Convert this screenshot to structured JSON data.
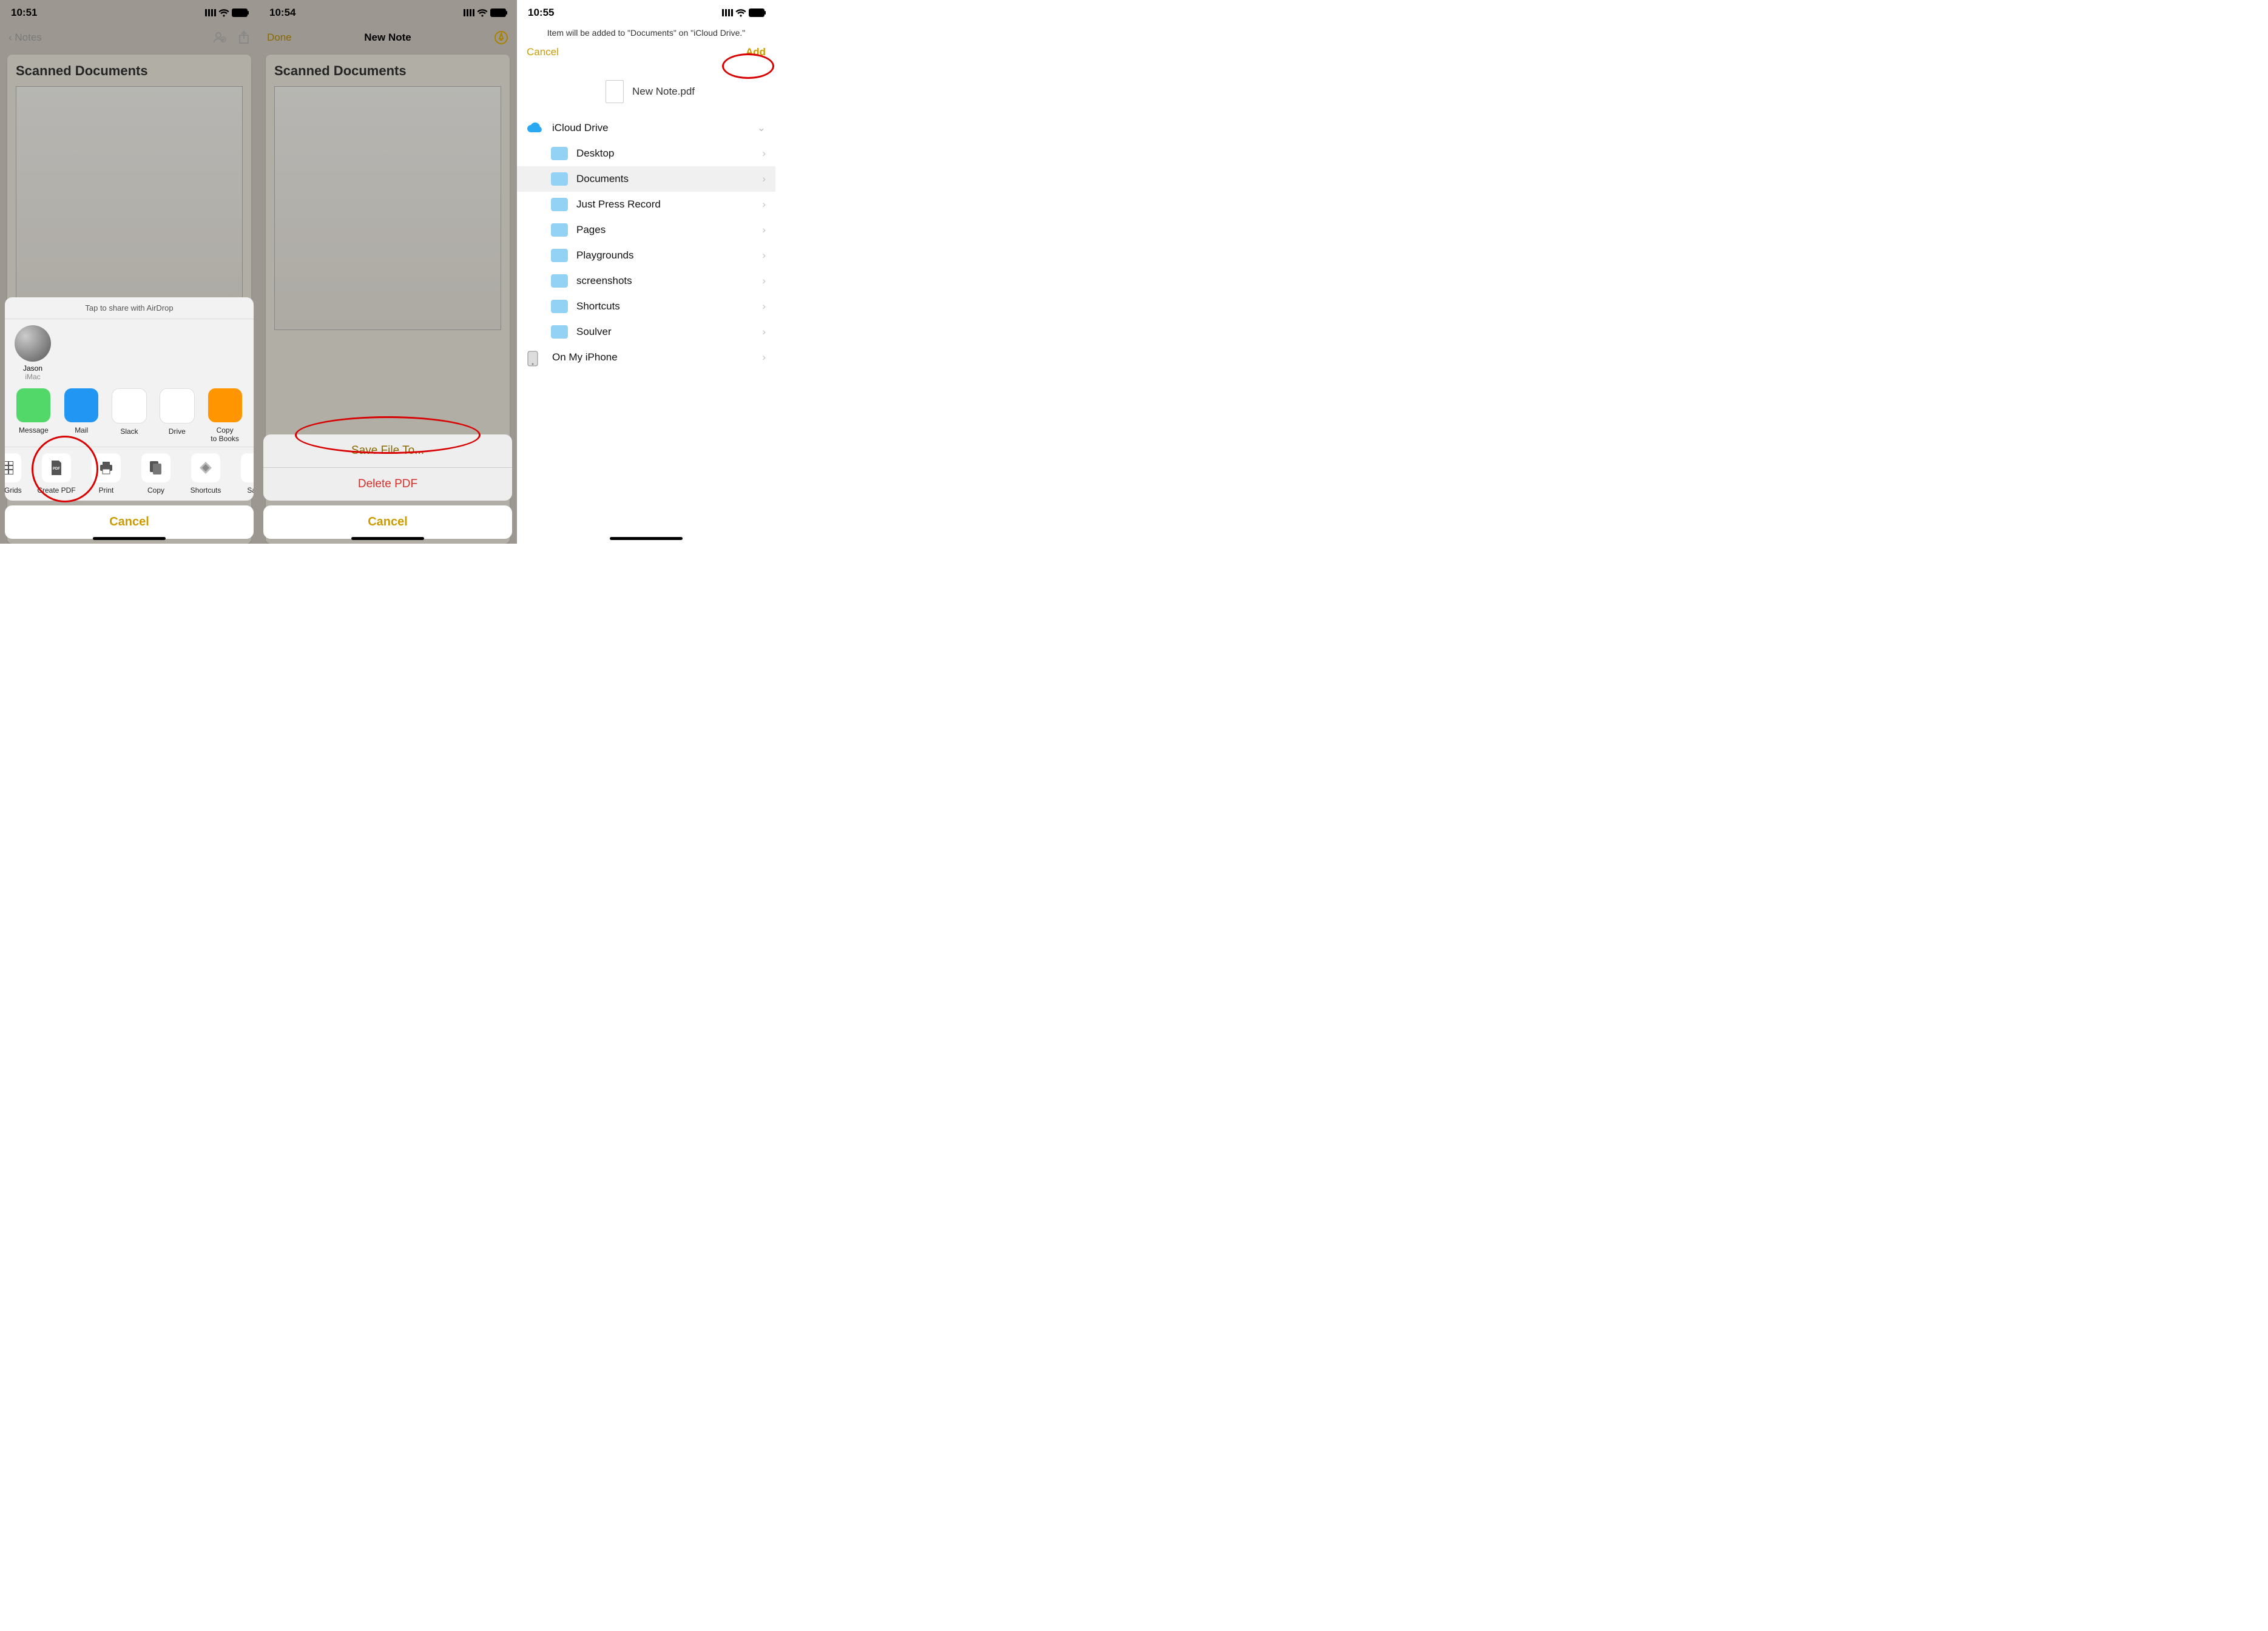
{
  "screens": [
    {
      "status_time": "10:51",
      "nav_back": "Notes",
      "note_heading": "Scanned Documents",
      "share": {
        "airdrop_prompt": "Tap to share with AirDrop",
        "airdrop_target": {
          "name": "Jason",
          "device": "iMac"
        },
        "apps": [
          "Message",
          "Mail",
          "Slack",
          "Drive",
          "Copy\nto Books"
        ],
        "actions": [
          "s & Grids",
          "Create PDF",
          "Print",
          "Copy",
          "Shortcuts",
          "Save"
        ],
        "cancel": "Cancel"
      }
    },
    {
      "status_time": "10:54",
      "nav_done": "Done",
      "nav_title": "New Note",
      "note_heading": "Scanned Documents",
      "menu": {
        "save": "Save File To...",
        "delete": "Delete PDF",
        "cancel": "Cancel"
      }
    },
    {
      "status_time": "10:55",
      "hint": "Item will be added to \"Documents\" on \"iCloud Drive.\"",
      "cancel": "Cancel",
      "add": "Add",
      "file_name": "New Note.pdf",
      "root": "iCloud Drive",
      "folders": [
        "Desktop",
        "Documents",
        "Just Press Record",
        "Pages",
        "Playgrounds",
        "screenshots",
        "Shortcuts",
        "Soulver"
      ],
      "selected_index": 1,
      "on_device": "On My iPhone"
    }
  ],
  "colors": {
    "accent": "#cc9b00",
    "destructive": "#d6302a"
  },
  "app_colors": [
    "#52d769",
    "#2196f3",
    "#ffffff",
    "#ffffff",
    "#ff9500"
  ]
}
